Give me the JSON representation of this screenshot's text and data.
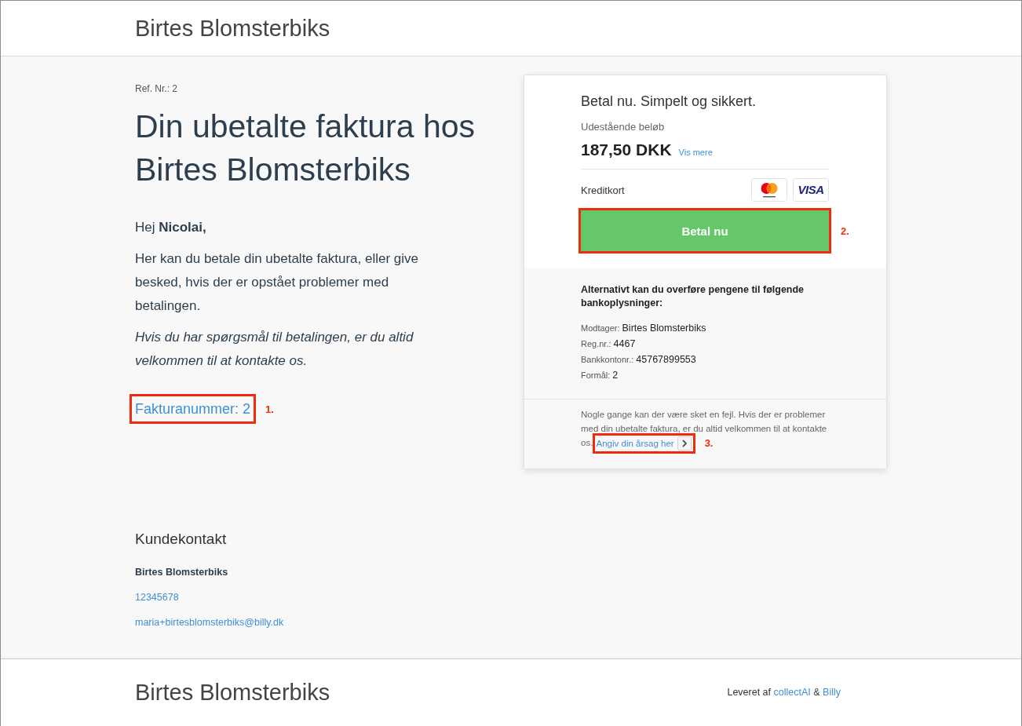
{
  "header": {
    "brand": "Birtes Blomsterbiks"
  },
  "invoice": {
    "reference": "Ref. Nr.: 2",
    "title": "Din ubetalte faktura hos Birtes Blomsterbiks",
    "greeting": "Hej **Nicolai,**",
    "intro": "Her kan du betale din ubetalte faktura, eller give besked, hvis der er opstået problemer med betalingen.",
    "note": "Hvis du har spørgsmål til betalingen, er du altid velkommen til at kontakte os.",
    "invoice_link": {
      "label": "Fakturanummer: 2",
      "callout": "1."
    }
  },
  "payment_card": {
    "title": "Betal nu. Simpelt og sikkert.",
    "amount_label": "Udestående beløb",
    "amount": "187,50 DKK",
    "details_link": "Vis mere",
    "method_label": "Kreditkort",
    "card_logos": [
      {
        "kind": "mastercard"
      },
      {
        "kind": "visa",
        "text": "VISA"
      }
    ],
    "pay_button": {
      "label": "Betal nu",
      "callout": "2."
    },
    "bank_transfer": {
      "heading": "Alternativt kan du overføre pengene til følgende bankoplysninger:",
      "fields": [
        {
          "label": "Modtager:",
          "value": "Birtes Blomsterbiks"
        },
        {
          "label": "Reg.nr.:",
          "value": "4467"
        },
        {
          "label": "Bankkontonr.:",
          "value": "45767899553"
        },
        {
          "label": "Formål:",
          "value": "2"
        }
      ]
    },
    "help": {
      "text": "Nogle gange kan der være sket en fejl. Hvis der er problemer med din ubetalte faktura, er du altid velkommen til at kontakte os.",
      "link": {
        "label": "Angiv din årsag her",
        "callout": "3."
      }
    }
  },
  "contact": {
    "heading": "Kundekontakt",
    "name": "Birtes Blomsterbiks",
    "phone": "12345678",
    "email": "maria+birtesblomsterbiks@billy.dk"
  },
  "footer": {
    "brand": "Birtes Blomsterbiks",
    "credit_prefix": "Leveret af",
    "credit_links": [
      "collectAI",
      "Billy"
    ],
    "credit_joiner": "&"
  }
}
